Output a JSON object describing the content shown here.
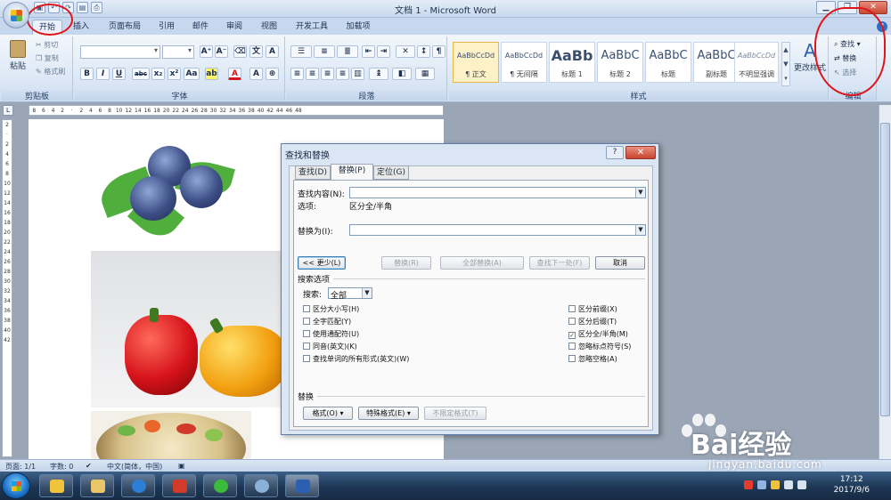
{
  "window": {
    "title": "文档 1 - Microsoft Word"
  },
  "qat_icons": [
    "save-icon",
    "undo-icon",
    "redo-icon",
    "print-preview-icon",
    "quick-print-icon"
  ],
  "tabs": [
    {
      "label": "开始",
      "active": true
    },
    {
      "label": "插入"
    },
    {
      "label": "页面布局"
    },
    {
      "label": "引用"
    },
    {
      "label": "邮件"
    },
    {
      "label": "审阅"
    },
    {
      "label": "视图"
    },
    {
      "label": "开发工具"
    },
    {
      "label": "加载项"
    }
  ],
  "ribbon": {
    "clipboard": {
      "label": "剪贴板",
      "paste": "粘贴",
      "cut": "剪切",
      "copy": "复制",
      "format_painter": "格式刷"
    },
    "font": {
      "label": "字体",
      "tools": [
        "B",
        "I",
        "U",
        "abc",
        "x₂",
        "x²",
        "Aa",
        "A"
      ],
      "size_tools": [
        "A⁺",
        "A⁻",
        "A"
      ]
    },
    "paragraph": {
      "label": "段落"
    },
    "styles": {
      "label": "样式",
      "items": [
        {
          "sample": "AaBbCcDd",
          "name": "¶ 正文"
        },
        {
          "sample": "AaBbCcDd",
          "name": "¶ 无间隔"
        },
        {
          "sample": "AaBb",
          "name": "标题 1"
        },
        {
          "sample": "AaBbC",
          "name": "标题 2"
        },
        {
          "sample": "AaBbC",
          "name": "标题"
        },
        {
          "sample": "AaBbC",
          "name": "副标题"
        },
        {
          "sample": "AaBbCcDd",
          "name": "不明显强调"
        }
      ],
      "change_styles": "更改样式"
    },
    "editing": {
      "label": "编辑",
      "find": "查找",
      "replace": "替换",
      "select": "选择"
    }
  },
  "dialog": {
    "title": "查找和替换",
    "help": "?",
    "close": "✕",
    "tabs": [
      {
        "label": "查找(D)"
      },
      {
        "label": "替换(P)",
        "active": true
      },
      {
        "label": "定位(G)"
      }
    ],
    "find_label": "查找内容(N):",
    "options_label": "选项:",
    "options_value": "区分全/半角",
    "replace_label": "替换为(I):",
    "buttons": {
      "less": "<< 更少(L)",
      "replace": "替换(R)",
      "replace_all": "全部替换(A)",
      "find_next": "查找下一处(F)",
      "cancel": "取消"
    },
    "search_options_title": "搜索选项",
    "search_label": "搜索:",
    "search_value": "全部",
    "left_checks": [
      {
        "label": "区分大小写(H)",
        "checked": false
      },
      {
        "label": "全字匹配(Y)",
        "checked": false
      },
      {
        "label": "使用通配符(U)",
        "checked": false
      },
      {
        "label": "同音(英文)(K)",
        "checked": false
      },
      {
        "label": "查找单词的所有形式(英文)(W)",
        "checked": false
      }
    ],
    "right_checks": [
      {
        "label": "区分前缀(X)",
        "checked": false
      },
      {
        "label": "区分后缀(T)",
        "checked": false
      },
      {
        "label": "区分全/半角(M)",
        "checked": true
      },
      {
        "label": "忽略标点符号(S)",
        "checked": false
      },
      {
        "label": "忽略空格(A)",
        "checked": false
      }
    ],
    "replace_section": "替换",
    "bottom_buttons": {
      "format": "格式(O) ▾",
      "special": "特殊格式(E) ▾",
      "no_format": "不限定格式(T)"
    }
  },
  "status": {
    "page": "页面: 1/1",
    "words": "字数: 0",
    "language": "中文(简体，中国)"
  },
  "taskbar": {
    "time": "17:12",
    "date": "2017/9/6"
  },
  "watermark": {
    "brand": "Bai经验",
    "site": "jingyan.baidu.com"
  }
}
